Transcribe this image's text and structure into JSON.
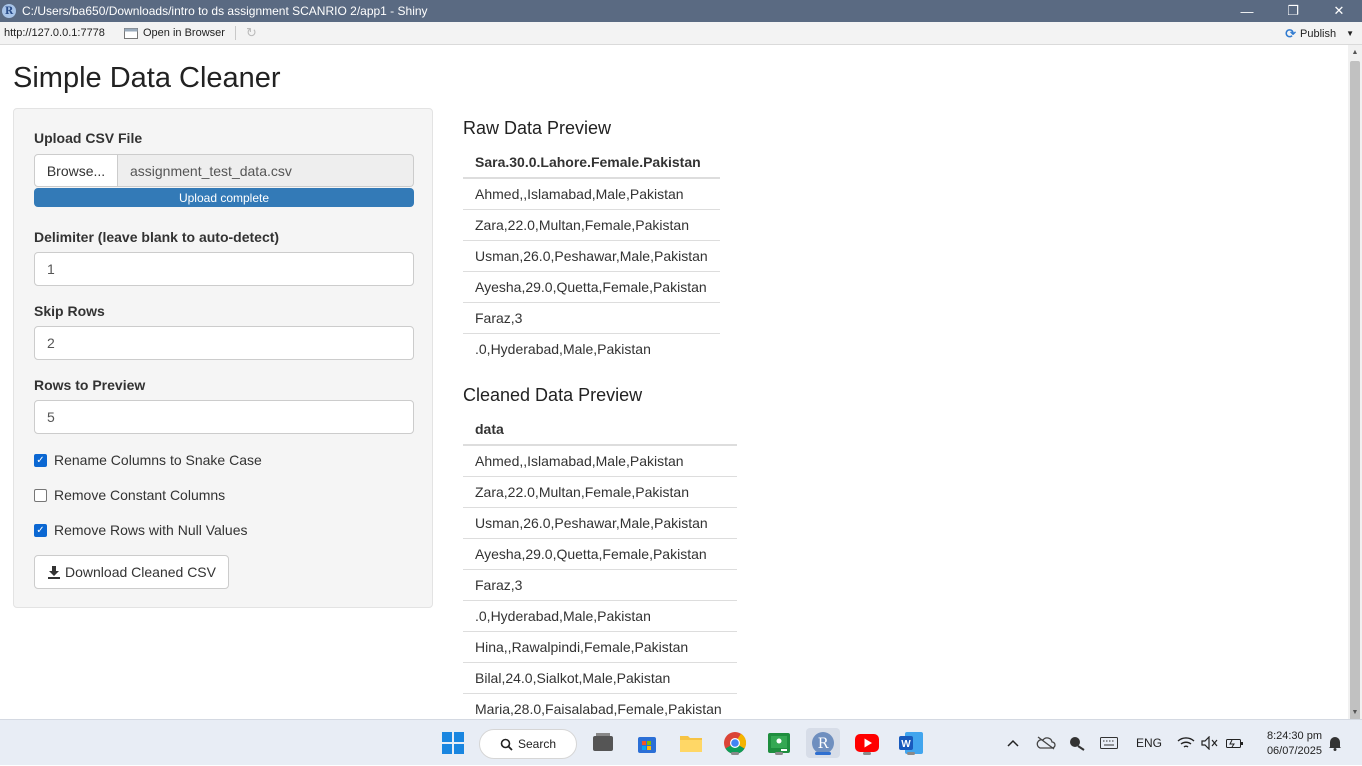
{
  "window": {
    "title": "C:/Users/ba650/Downloads/intro to ds assignment SCANRIO 2/app1 - Shiny",
    "app_icon_letter": "R",
    "minimize": "—",
    "restore": "❐",
    "close": "✕"
  },
  "addressbar": {
    "url": "http://127.0.0.1:7778",
    "open_in_browser": "Open in Browser",
    "publish": "Publish"
  },
  "page": {
    "title": "Simple Data Cleaner"
  },
  "sidebar": {
    "upload_label": "Upload CSV File",
    "browse_label": "Browse...",
    "file_name": "assignment_test_data.csv",
    "upload_progress": 1.0,
    "upload_status": "Upload complete",
    "delimiter_label": "Delimiter (leave blank to auto-detect)",
    "delimiter_value": "1",
    "skip_label": "Skip Rows",
    "skip_value": "2",
    "preview_label": "Rows to Preview",
    "preview_value": "5",
    "checkboxes": [
      {
        "label": "Rename Columns to Snake Case",
        "checked": true
      },
      {
        "label": "Remove Constant Columns",
        "checked": false
      },
      {
        "label": "Remove Rows with Null Values",
        "checked": true
      }
    ],
    "download_label": "Download Cleaned CSV"
  },
  "raw_preview": {
    "heading": "Raw Data Preview",
    "column": "Sara.30.0.Lahore.Female.Pakistan",
    "rows": [
      "Ahmed,,Islamabad,Male,Pakistan",
      "Zara,22.0,Multan,Female,Pakistan",
      "Usman,26.0,Peshawar,Male,Pakistan",
      "Ayesha,29.0,Quetta,Female,Pakistan",
      "Faraz,3",
      ".0,Hyderabad,Male,Pakistan"
    ]
  },
  "clean_preview": {
    "heading": "Cleaned Data Preview",
    "column": "data",
    "rows": [
      "Ahmed,,Islamabad,Male,Pakistan",
      "Zara,22.0,Multan,Female,Pakistan",
      "Usman,26.0,Peshawar,Male,Pakistan",
      "Ayesha,29.0,Quetta,Female,Pakistan",
      "Faraz,3",
      ".0,Hyderabad,Male,Pakistan",
      "Hina,,Rawalpindi,Female,Pakistan",
      "Bilal,24.0,Sialkot,Male,Pakistan",
      "Maria,28.0,Faisalabad,Female,Pakistan"
    ]
  },
  "taskbar": {
    "search_label": "Search",
    "language": "ENG",
    "time": "8:24:30 pm",
    "date": "06/07/2025",
    "colors": {
      "chrome": "#4285f4",
      "youtube": "#ff0000",
      "word": "#185abd",
      "files": "#f6c343",
      "r": "#6f8fbf"
    }
  }
}
